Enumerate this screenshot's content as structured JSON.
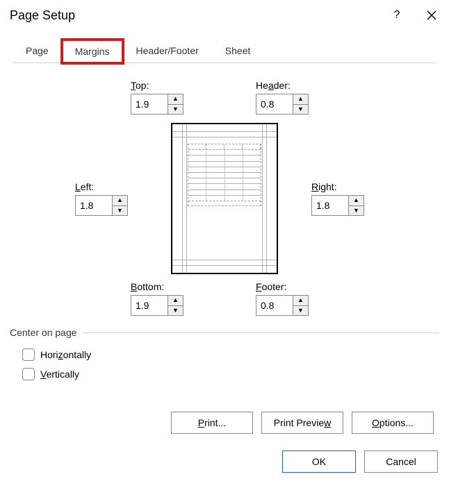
{
  "title": "Page Setup",
  "tabs": {
    "page": "Page",
    "margins": "Margins",
    "header_footer": "Header/Footer",
    "sheet": "Sheet"
  },
  "margins": {
    "top_label": "Top:",
    "top_value": "1.9",
    "header_label": "Header:",
    "header_value": "0.8",
    "left_label": "Left:",
    "left_value": "1.8",
    "right_label": "Right:",
    "right_value": "1.8",
    "bottom_label": "Bottom:",
    "bottom_value": "1.9",
    "footer_label": "Footer:",
    "footer_value": "0.8"
  },
  "center_on_page": {
    "title": "Center on page",
    "horizontally": "Horizontally",
    "vertically": "Vertically"
  },
  "buttons": {
    "print": "Print...",
    "print_preview": "Print Preview",
    "options": "Options...",
    "ok": "OK",
    "cancel": "Cancel"
  }
}
